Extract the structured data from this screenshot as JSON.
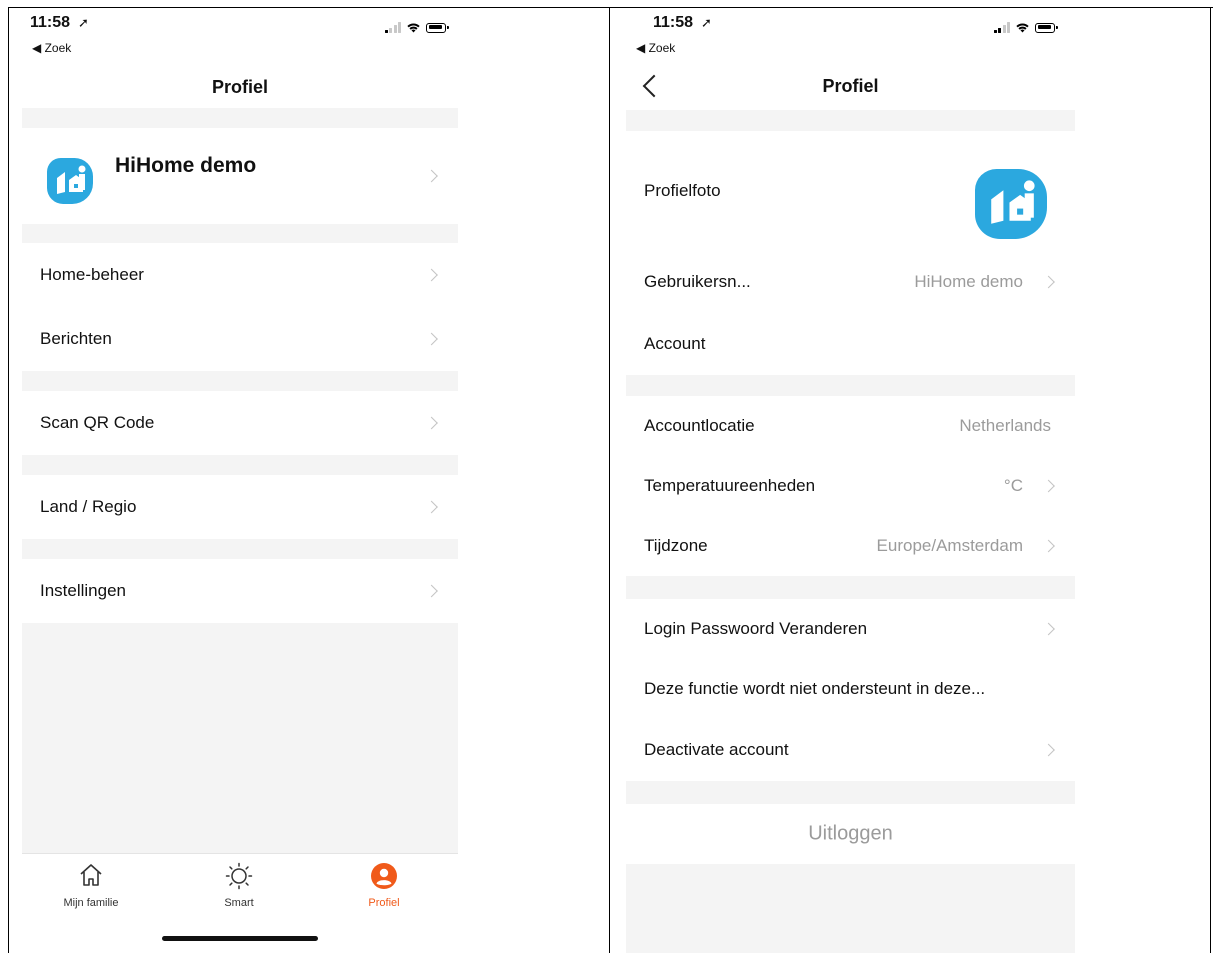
{
  "left": {
    "status": {
      "time": "11:58",
      "back": "Zoek"
    },
    "title": "Profiel",
    "profile": {
      "name": "HiHome demo"
    },
    "menu": [
      "Home-beheer",
      "Berichten",
      "Scan QR Code",
      "Land / Regio",
      "Instellingen"
    ],
    "tabs": [
      {
        "label": "Mijn familie",
        "icon": "home-icon"
      },
      {
        "label": "Smart",
        "icon": "sun-icon"
      },
      {
        "label": "Profiel",
        "icon": "user-icon"
      }
    ],
    "active_tab": "Profiel"
  },
  "right": {
    "status": {
      "time": "11:58",
      "back": "Zoek"
    },
    "title": "Profiel",
    "rows": {
      "photo": "Profielfoto",
      "username_label": "Gebruikersn...",
      "username_value": "HiHome demo",
      "account": "Account",
      "location_label": "Accountlocatie",
      "location_value": "Netherlands",
      "temp_label": "Temperatuureenheden",
      "temp_value": "°C",
      "timezone_label": "Tijdzone",
      "timezone_value": "Europe/Amsterdam",
      "password": "Login Passwoord Veranderen",
      "unsupported": "Deze functie wordt niet ondersteunt in deze...",
      "deactivate": "Deactivate account",
      "logout": "Uitloggen"
    }
  },
  "colors": {
    "accent": "#f05a1a",
    "logo_blue": "#2ba8df",
    "separator": "#f4f4f4"
  }
}
